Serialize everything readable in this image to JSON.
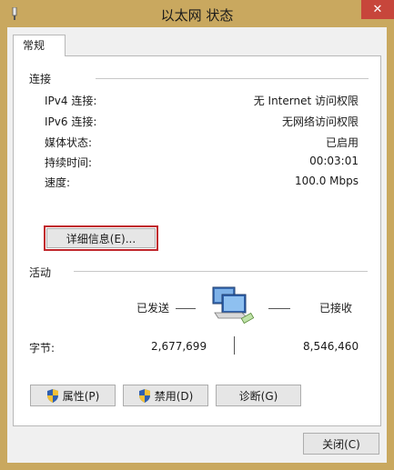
{
  "window": {
    "title": "以太网 状态",
    "close_glyph": "✕"
  },
  "tabs": [
    {
      "label": "常规"
    }
  ],
  "connection": {
    "group_title": "连接",
    "rows": [
      {
        "label": "IPv4 连接:",
        "value": "无 Internet 访问权限"
      },
      {
        "label": "IPv6 连接:",
        "value": "无网络访问权限"
      },
      {
        "label": "媒体状态:",
        "value": "已启用"
      },
      {
        "label": "持续时间:",
        "value": "00:03:01"
      },
      {
        "label": "速度:",
        "value": "100.0 Mbps"
      }
    ],
    "details_button": "详细信息(E)..."
  },
  "activity": {
    "group_title": "活动",
    "sent_label": "已发送",
    "received_label": "已接收",
    "bytes_label": "字节:",
    "bytes_sent": "2,677,699",
    "bytes_received": "8,546,460"
  },
  "buttons": {
    "properties": "属性(P)",
    "disable": "禁用(D)",
    "diagnose": "诊断(G)",
    "close": "关闭(C)"
  },
  "icons": {
    "app": "network-adapter-icon",
    "network": "network-computers-icon",
    "shield": "uac-shield-icon"
  },
  "colors": {
    "frame": "#c9a85f",
    "close_button": "#c7463b",
    "focus_outline": "#c0262c"
  }
}
